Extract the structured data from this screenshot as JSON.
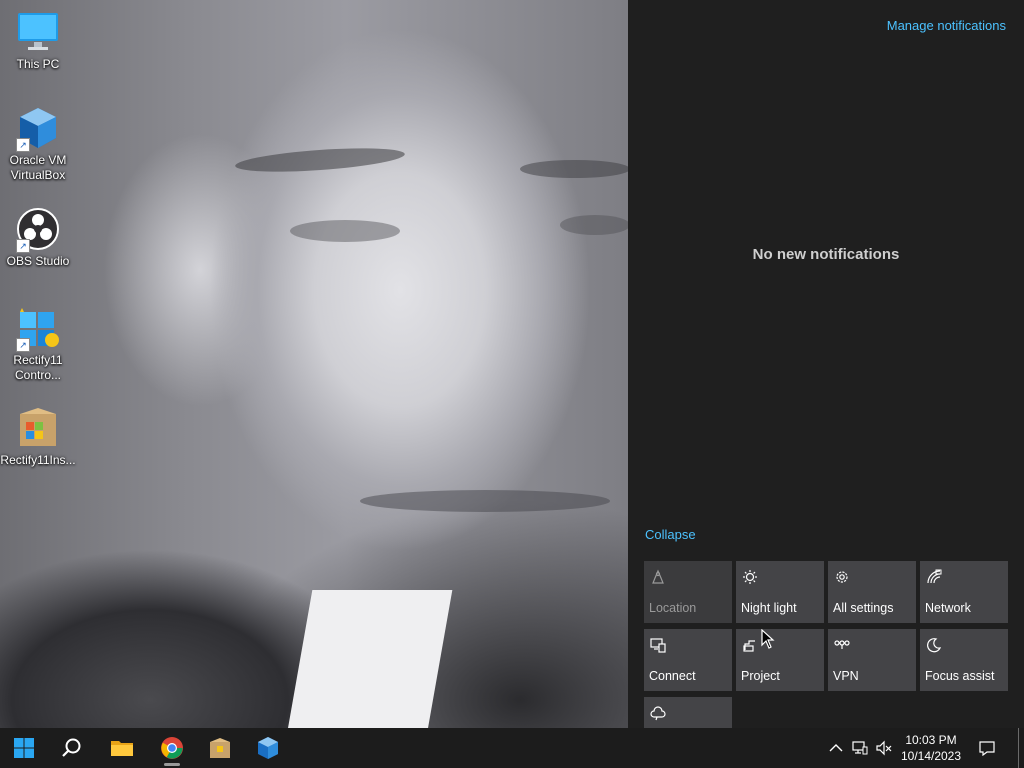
{
  "desktop": {
    "icons": [
      {
        "label": "This PC",
        "icon": "this-pc-icon"
      },
      {
        "label": "Oracle VM VirtualBox",
        "icon": "virtualbox-icon"
      },
      {
        "label": "OBS Studio",
        "icon": "obs-studio-icon"
      },
      {
        "label": "Rectify11 Contro...",
        "icon": "rectify11-control-icon"
      },
      {
        "label": "Rectify11Ins...",
        "icon": "rectify11-installer-icon"
      }
    ]
  },
  "action_center": {
    "manage_notifications": "Manage notifications",
    "empty_message": "No new notifications",
    "collapse": "Collapse",
    "quick_actions": [
      {
        "label": "Location",
        "icon": "location-icon",
        "enabled": false
      },
      {
        "label": "Night light",
        "icon": "night-light-icon",
        "enabled": true
      },
      {
        "label": "All settings",
        "icon": "gear-icon",
        "enabled": true
      },
      {
        "label": "Network",
        "icon": "network-icon",
        "enabled": true
      },
      {
        "label": "Connect",
        "icon": "connect-icon",
        "enabled": true
      },
      {
        "label": "Project",
        "icon": "project-icon",
        "enabled": true
      },
      {
        "label": "VPN",
        "icon": "vpn-icon",
        "enabled": true
      },
      {
        "label": "Focus assist",
        "icon": "moon-icon",
        "enabled": true
      },
      {
        "label": "",
        "icon": "cloud-icon",
        "enabled": true
      }
    ]
  },
  "taskbar": {
    "pinned": [
      {
        "name": "start-button",
        "icon": "windows-logo-icon"
      },
      {
        "name": "search-button",
        "icon": "search-icon"
      },
      {
        "name": "file-explorer",
        "icon": "folder-icon"
      },
      {
        "name": "chrome",
        "icon": "chrome-icon"
      },
      {
        "name": "rectify11-installer",
        "icon": "package-icon"
      },
      {
        "name": "virtualbox",
        "icon": "virtualbox-icon"
      }
    ],
    "tray": {
      "icons": [
        "chevron-up-icon",
        "network-icon",
        "volume-muted-icon"
      ],
      "time": "10:03 PM",
      "date": "10/14/2023",
      "notification_icon": "notification-icon"
    }
  },
  "colors": {
    "accent": "#4cc2ff",
    "panel_bg": "#1f1f1f",
    "tile_bg": "#444447",
    "taskbar_bg": "#1c1c1c"
  }
}
